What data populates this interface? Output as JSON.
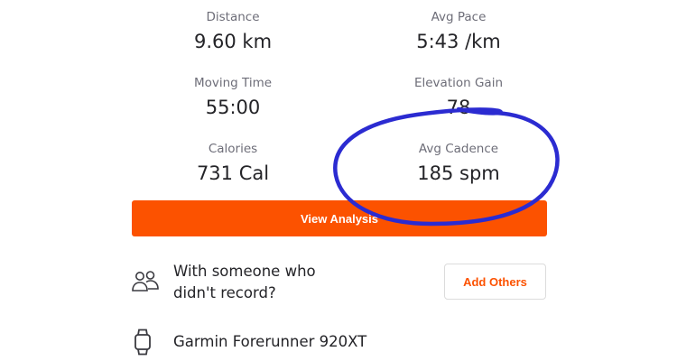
{
  "stats": {
    "distance": {
      "label": "Distance",
      "value": "9.60 km"
    },
    "avg_pace": {
      "label": "Avg Pace",
      "value": "5:43 /km"
    },
    "moving_time": {
      "label": "Moving Time",
      "value": "55:00"
    },
    "elevation_gain": {
      "label": "Elevation Gain",
      "value": "78"
    },
    "calories": {
      "label": "Calories",
      "value": "731 Cal"
    },
    "avg_cadence": {
      "label": "Avg Cadence",
      "value": "185 spm"
    }
  },
  "analysis_button": {
    "label": "View Analysis"
  },
  "partner_prompt": {
    "line1": "With someone who",
    "line2": "didn't record?",
    "icon": "people-icon",
    "button_label": "Add Others"
  },
  "device": {
    "name": "Garmin Forerunner 920XT",
    "icon": "watch-icon"
  },
  "colors": {
    "accent": "#fc5200",
    "annotation": "#2b2bd1",
    "label_gray": "#6d6d78",
    "text": "#242428"
  }
}
